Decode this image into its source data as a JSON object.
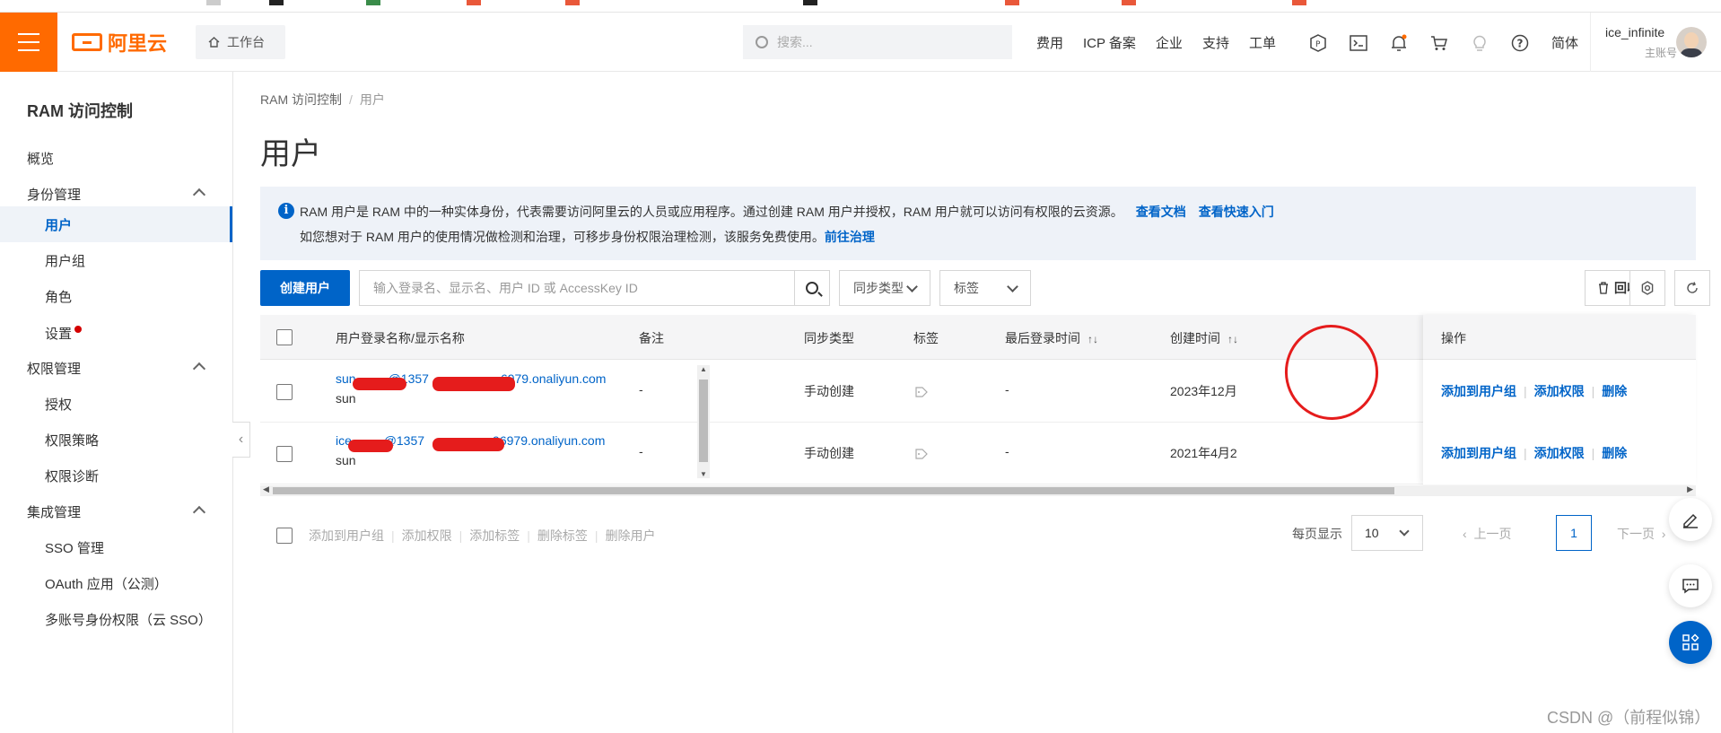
{
  "header": {
    "logo_text": "阿里云",
    "workbench_label": "工作台",
    "search_placeholder": "搜索...",
    "nav_links": [
      "费用",
      "ICP 备案",
      "企业",
      "支持",
      "工单"
    ],
    "language": "简体",
    "user_name": "ice_infinite",
    "user_role": "主账号"
  },
  "sidebar": {
    "title": "RAM 访问控制",
    "items": {
      "overview": "概览",
      "identity_group": "身份管理",
      "users": "用户",
      "user_groups": "用户组",
      "roles": "角色",
      "settings": "设置",
      "permission_group": "权限管理",
      "grants": "授权",
      "policies": "权限策略",
      "diagnosis": "权限诊断",
      "integration_group": "集成管理",
      "sso": "SSO 管理",
      "oauth": "OAuth 应用（公测）",
      "multi_sso": "多账号身份权限（云 SSO）"
    }
  },
  "main": {
    "breadcrumb": [
      "RAM 访问控制",
      "用户"
    ],
    "page_title": "用户",
    "notice": {
      "line1": "RAM 用户是 RAM 中的一种实体身份，代表需要访问阿里云的人员或应用程序。通过创建 RAM 用户并授权，RAM 用户就可以访问有权限的云资源。",
      "link_docs": "查看文档",
      "link_quickstart": "查看快速入门",
      "line2": "如您想对于 RAM 用户的使用情况做检测和治理，可移步身份权限治理检测，该服务免费使用。",
      "link_govern": "前往治理"
    },
    "toolbar": {
      "create_user": "创建用户",
      "search_placeholder": "输入登录名、显示名、用户 ID 或 AccessKey ID",
      "sync_type": "同步类型",
      "tags": "标签",
      "recycle_bin": "回收站"
    },
    "table": {
      "headers": {
        "name": "用户登录名称/显示名称",
        "remark": "备注",
        "sync_type": "同步类型",
        "tags": "标签",
        "last_login": "最后登录时间",
        "created": "创建时间",
        "actions": "操作"
      },
      "rows": [
        {
          "login_prefix": "sun",
          "login_mid": "@1357",
          "login_suffix": "6979.onaliyun.com",
          "display_name": "sun",
          "remark": "-",
          "sync_type": "手动创建",
          "last_login": "-",
          "created": "2023年12月",
          "action_add_group": "添加到用户组",
          "action_add_perm": "添加权限",
          "action_delete": "删除"
        },
        {
          "login_prefix": "ice_",
          "login_mid": "@1357",
          "login_suffix": "96979.onaliyun.com",
          "display_name": "sun",
          "remark": "-",
          "sync_type": "手动创建",
          "last_login": "-",
          "created": "2021年4月2",
          "action_add_group": "添加到用户组",
          "action_add_perm": "添加权限",
          "action_delete": "删除"
        }
      ]
    },
    "bulk_actions": [
      "添加到用户组",
      "添加权限",
      "添加标签",
      "删除标签",
      "删除用户"
    ],
    "pagination": {
      "per_page_label": "每页显示",
      "per_page": "10",
      "prev": "上一页",
      "current_page": "1",
      "next": "下一页"
    }
  },
  "watermark": "CSDN @（前程似锦）",
  "colors": {
    "brand_orange": "#ff6a00",
    "primary_blue": "#0064c8",
    "annotation_red": "#e51c1c"
  }
}
